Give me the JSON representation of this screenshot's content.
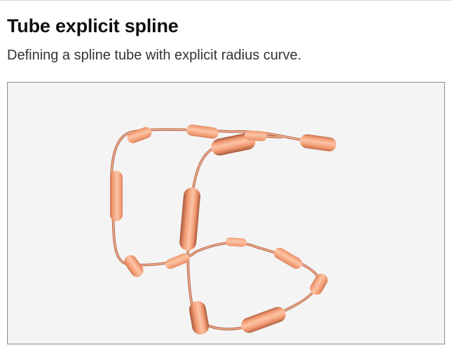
{
  "header": {
    "title": "Tube explicit spline",
    "subtitle": "Defining a spline tube with explicit radius curve."
  },
  "scene": {
    "background_color": "#f4f4f4",
    "border_color": "#8a8a8a",
    "tube_color": "#f39a72",
    "tube_shadow_color": "#a8583a",
    "tube_highlight_color": "#fbc4a6"
  }
}
